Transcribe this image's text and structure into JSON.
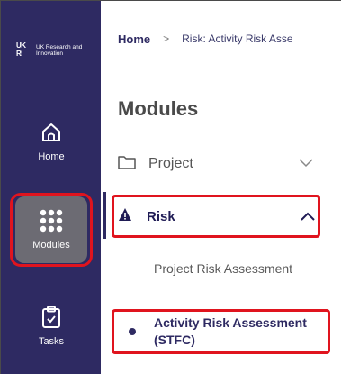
{
  "logo": {
    "mark": "UK RI",
    "text": "UK Research and Innovation"
  },
  "sidebar": {
    "items": [
      {
        "label": "Home",
        "icon": "home-icon"
      },
      {
        "label": "Modules",
        "icon": "grid-icon"
      },
      {
        "label": "Tasks",
        "icon": "clipboard-check-icon"
      }
    ]
  },
  "breadcrumb": {
    "home": "Home",
    "separator": ">",
    "current": "Risk: Activity Risk Asse"
  },
  "main": {
    "title": "Modules",
    "modules": [
      {
        "label": "Project",
        "icon": "folder-icon"
      },
      {
        "label": "Risk",
        "icon": "warning-icon"
      }
    ],
    "risk_subitems": [
      {
        "label": "Project Risk Assessment"
      },
      {
        "label": "Activity Risk Assessment (STFC)"
      }
    ]
  },
  "colors": {
    "sidebar": "#2e2a62",
    "highlight": "#e0141e",
    "active_tile": "#6c6b73"
  }
}
